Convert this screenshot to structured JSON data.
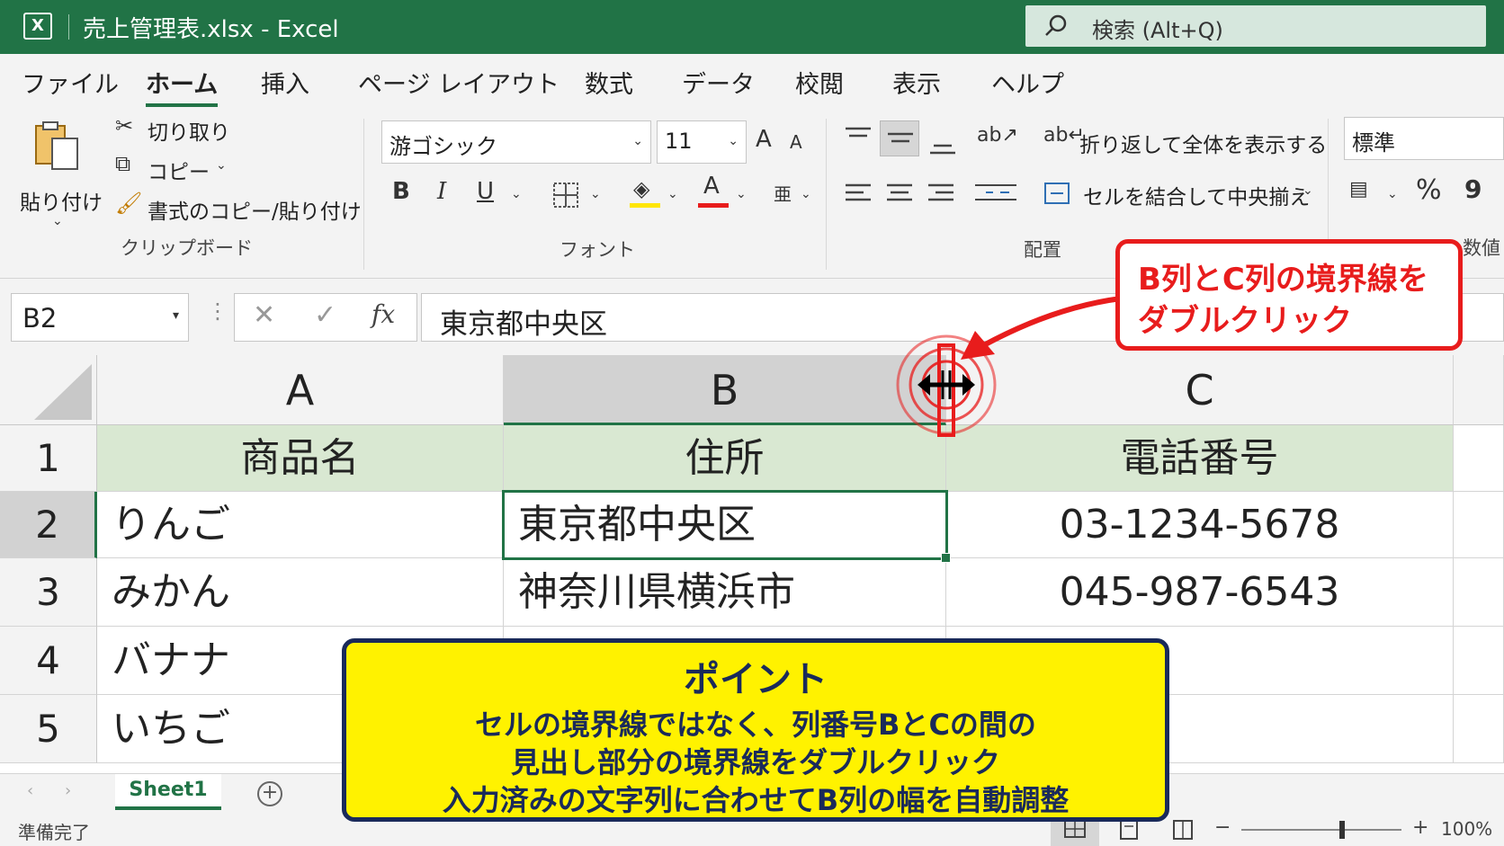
{
  "title_bar": {
    "title": "売上管理表.xlsx  -  Excel",
    "search_text": "検索 (Alt+Q)"
  },
  "menu_tabs": [
    "ファイル",
    "ホーム",
    "挿入",
    "ページ レイアウト",
    "数式",
    "データ",
    "校閲",
    "表示",
    "ヘルプ"
  ],
  "active_tab": "ホーム",
  "ribbon": {
    "clipboard": {
      "paste": "貼り付け",
      "cut": "切り取り",
      "copy": "コピー",
      "format_painter": "書式のコピー/貼り付け",
      "group_label": "クリップボード"
    },
    "font": {
      "font_name": "游ゴシック",
      "font_size": "11",
      "bold": "B",
      "italic": "I",
      "underline": "U",
      "font_color_glyph": "A",
      "grow_glyph": "A",
      "shrink_glyph": "A",
      "group_label": "フォント",
      "highlight_color": "#ffe600",
      "font_color": "#e81c1c"
    },
    "alignment": {
      "wrap_text": "折り返して全体を表示する",
      "merge_center": "セルを結合して中央揃え",
      "group_label": "配置"
    },
    "number": {
      "format": "標準",
      "percent": "%",
      "comma": "9",
      "group_label": "数値"
    }
  },
  "formula_bar": {
    "name_box": "B2",
    "fx": "fx",
    "formula": "東京都中央区"
  },
  "columns": [
    "A",
    "B",
    "C"
  ],
  "rows": [
    {
      "row": "1",
      "cells": [
        "商品名",
        "住所",
        "電話番号"
      ]
    },
    {
      "row": "2",
      "cells": [
        "りんご",
        "東京都中央区",
        "03-1234-5678"
      ]
    },
    {
      "row": "3",
      "cells": [
        "みかん",
        "神奈川県横浜市",
        "045-987-6543"
      ]
    },
    {
      "row": "4",
      "cells": [
        "バナナ",
        "",
        ""
      ]
    },
    {
      "row": "5",
      "cells": [
        "いちご",
        "",
        ""
      ]
    }
  ],
  "sheet_tabs": {
    "active": "Sheet1",
    "add_glyph": "+"
  },
  "status_bar": {
    "status": "準備完了",
    "zoom": "100%",
    "zoom_minus": "−",
    "zoom_plus": "+"
  },
  "callout": {
    "line1": "B列とC列の境界線を",
    "line2": "ダブルクリック"
  },
  "point_box": {
    "title": "ポイント",
    "line1": "セルの境界線ではなく、列番号BとCの間の",
    "line2": "見出し部分の境界線をダブルクリック",
    "line3": "入力済みの文字列に合わせてB列の幅を自動調整"
  },
  "colors": {
    "excel_green": "#217346",
    "header_fill": "#d9e8d2",
    "annotation_red": "#e81c1c",
    "point_yellow": "#fff200",
    "point_navy": "#1a2a5a"
  }
}
